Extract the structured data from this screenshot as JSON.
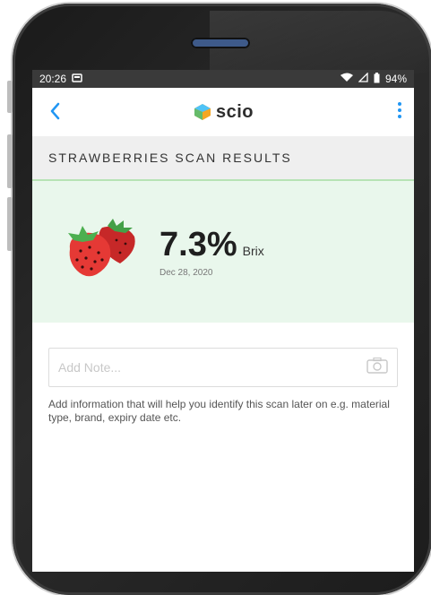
{
  "status": {
    "time": "20:26",
    "battery": "94%"
  },
  "app": {
    "logo": "scio",
    "logo_sup": "i-o"
  },
  "header": {
    "title": "STRAWBERRIES SCAN RESULTS"
  },
  "result": {
    "value": "7.3%",
    "unit": "Brix",
    "date": "Dec 28, 2020"
  },
  "note": {
    "placeholder": "Add Note...",
    "help": "Add information that will help you identify this scan later on e.g. material type, brand, expiry date etc."
  },
  "icons": {
    "back": "chevron-left-icon",
    "more": "more-vertical-icon",
    "camera": "camera-icon",
    "wifi": "wifi-icon",
    "signal": "signal-icon",
    "battery": "battery-icon",
    "notification": "notification-icon"
  },
  "colors": {
    "accent": "#2196f3",
    "result_bg": "#e9f7ec",
    "strawberry": "#d32f2f"
  }
}
